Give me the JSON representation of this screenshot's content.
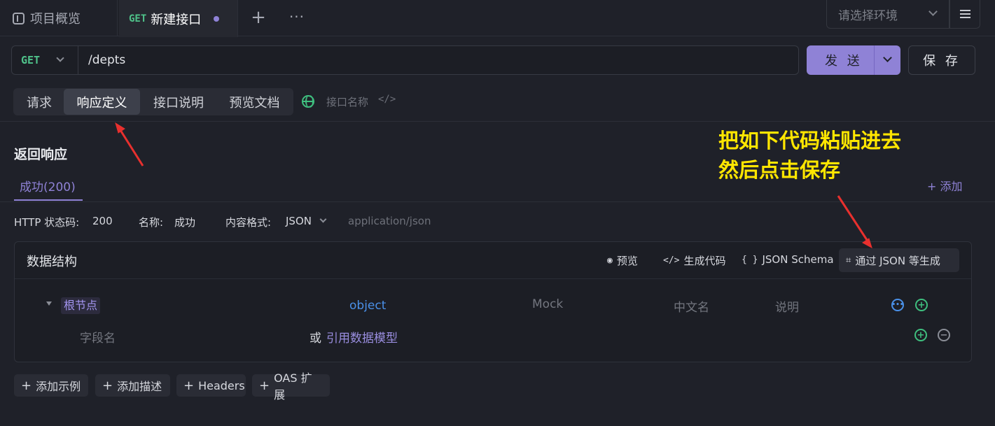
{
  "tabs": {
    "overview_label": "项目概览",
    "active_method": "GET",
    "active_name": "新建接口",
    "plus": "+",
    "more": "···"
  },
  "env": {
    "placeholder": "请选择环境"
  },
  "request": {
    "method": "GET",
    "url": "/depts",
    "send_label": "发 送",
    "save_label": "保 存"
  },
  "subtabs": {
    "items": [
      {
        "label": "请求",
        "active": false
      },
      {
        "label": "响应定义",
        "active": true
      },
      {
        "label": "接口说明",
        "active": false
      },
      {
        "label": "预览文档",
        "active": false
      }
    ],
    "api_name_placeholder": "接口名称",
    "code_icon": "</>"
  },
  "response": {
    "section_title": "返回响应",
    "tab_label": "成功(200)",
    "add_label": "+ 添加",
    "status_code_label": "HTTP 状态码:",
    "status_code_value": "200",
    "name_label": "名称:",
    "name_value": "成功",
    "format_label": "内容格式:",
    "format_value": "JSON",
    "content_type": "application/json"
  },
  "data_structure": {
    "title": "数据结构",
    "actions": {
      "preview": "预览",
      "gen_code": "生成代码",
      "json_schema": "JSON Schema",
      "gen_from_json": "通过 JSON 等生成"
    },
    "root_node": "根节点",
    "root_type": "object",
    "col_mock": "Mock",
    "col_cn_name": "中文名",
    "col_desc": "说明",
    "field_name_placeholder": "字段名",
    "or_text": "或",
    "ref_model": "引用数据模型"
  },
  "bottom_buttons": {
    "add_example": "添加示例",
    "add_desc": "添加描述",
    "headers": "Headers",
    "oas_ext": "OAS 扩展"
  },
  "annotation": {
    "line1": "把如下代码粘贴进去",
    "line2": "然后点击保存",
    "color": "#ffe600"
  },
  "colors": {
    "accent": "#8f82d6",
    "get_method": "#4fc28a",
    "arrow": "#e8302e"
  }
}
